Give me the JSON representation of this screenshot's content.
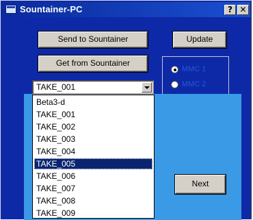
{
  "window": {
    "title": "Sountainer-PC",
    "help_button": "?",
    "close_button": "✕"
  },
  "toolbar": {
    "send_label": "Send to Sountainer",
    "update_label": "Update",
    "get_label": "Get from Sountainer",
    "next_label": "Next"
  },
  "take_select": {
    "selected_value": "TAKE_001",
    "options": [
      "Beta3-d",
      "TAKE_001",
      "TAKE_002",
      "TAKE_003",
      "TAKE_004",
      "TAKE_005",
      "TAKE_006",
      "TAKE_007",
      "TAKE_008",
      "TAKE_009"
    ],
    "highlighted_index": 5
  },
  "mmc": {
    "options": [
      {
        "label": "MMC 1",
        "selected": true
      },
      {
        "label": "MMC 2",
        "selected": false
      }
    ]
  },
  "colors": {
    "window_bg": "#0d29a8",
    "panel_bg": "#3a9ae6",
    "radio_text": "#1f58d8",
    "highlight": "#0a2470"
  }
}
